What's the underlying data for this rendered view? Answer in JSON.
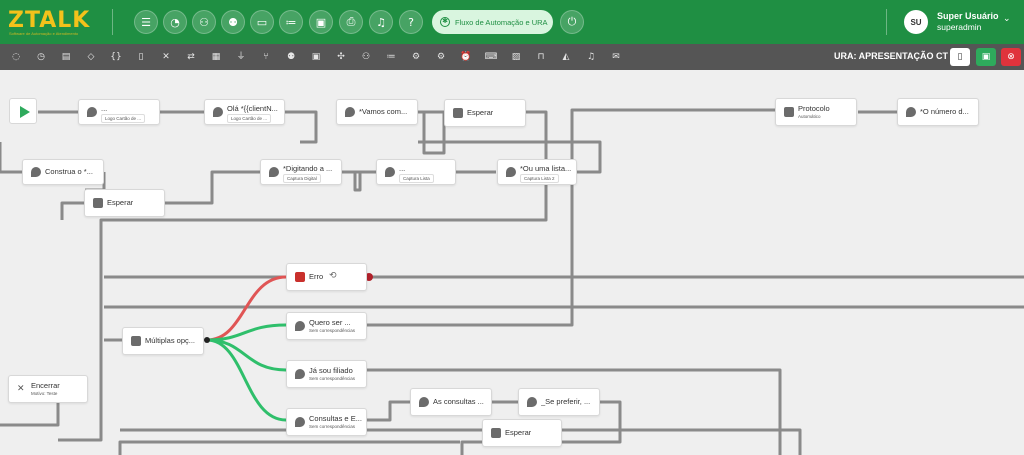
{
  "brand": {
    "name": "ZTALK",
    "tagline": "Software de Automação e Atendimento"
  },
  "header": {
    "active_pill": "Fluxo de Automação e URA",
    "user": {
      "initials": "SU",
      "name": "Super Usuário",
      "role": "superadmin"
    }
  },
  "toolbar": {
    "ura_label": "URA: APRESENTAÇÃO CT"
  },
  "nodes": {
    "n1": {
      "title": "...",
      "sub": "Logo Cartão de ..."
    },
    "n2": {
      "title": "Olá *{{clientN...",
      "sub": "Logo Cartão de ..."
    },
    "n3": {
      "title": "*Vamos com..."
    },
    "n4": {
      "title": "Esperar"
    },
    "n5": {
      "title": "Protocolo",
      "sub": "Automático"
    },
    "n6": {
      "title": "*O número d..."
    },
    "n7": {
      "title": "Construa o *..."
    },
    "n8": {
      "title": "Esperar"
    },
    "n9": {
      "title": "*Digitando a ...",
      "sub": "Captura Digital"
    },
    "n10": {
      "title": "...",
      "sub": "Captura Lista"
    },
    "n11": {
      "title": "*Ou uma lista...",
      "sub": "Captura Lista 2"
    },
    "n12": {
      "title": "Erro"
    },
    "n13": {
      "title": "Múltiplas opç..."
    },
    "n14": {
      "title": "Quero ser ...",
      "sub": "Sem correspondências"
    },
    "n15": {
      "title": "Já sou filiado",
      "sub": "Sem correspondências"
    },
    "n16": {
      "title": "Consultas e E...",
      "sub": "Sem correspondências"
    },
    "n17": {
      "title": "As consultas ..."
    },
    "n18": {
      "title": "_Se preferir, ..."
    },
    "n19": {
      "title": "Esperar"
    },
    "n20": {
      "title": "Encerrar",
      "sub": "Motivo: Teste"
    }
  }
}
